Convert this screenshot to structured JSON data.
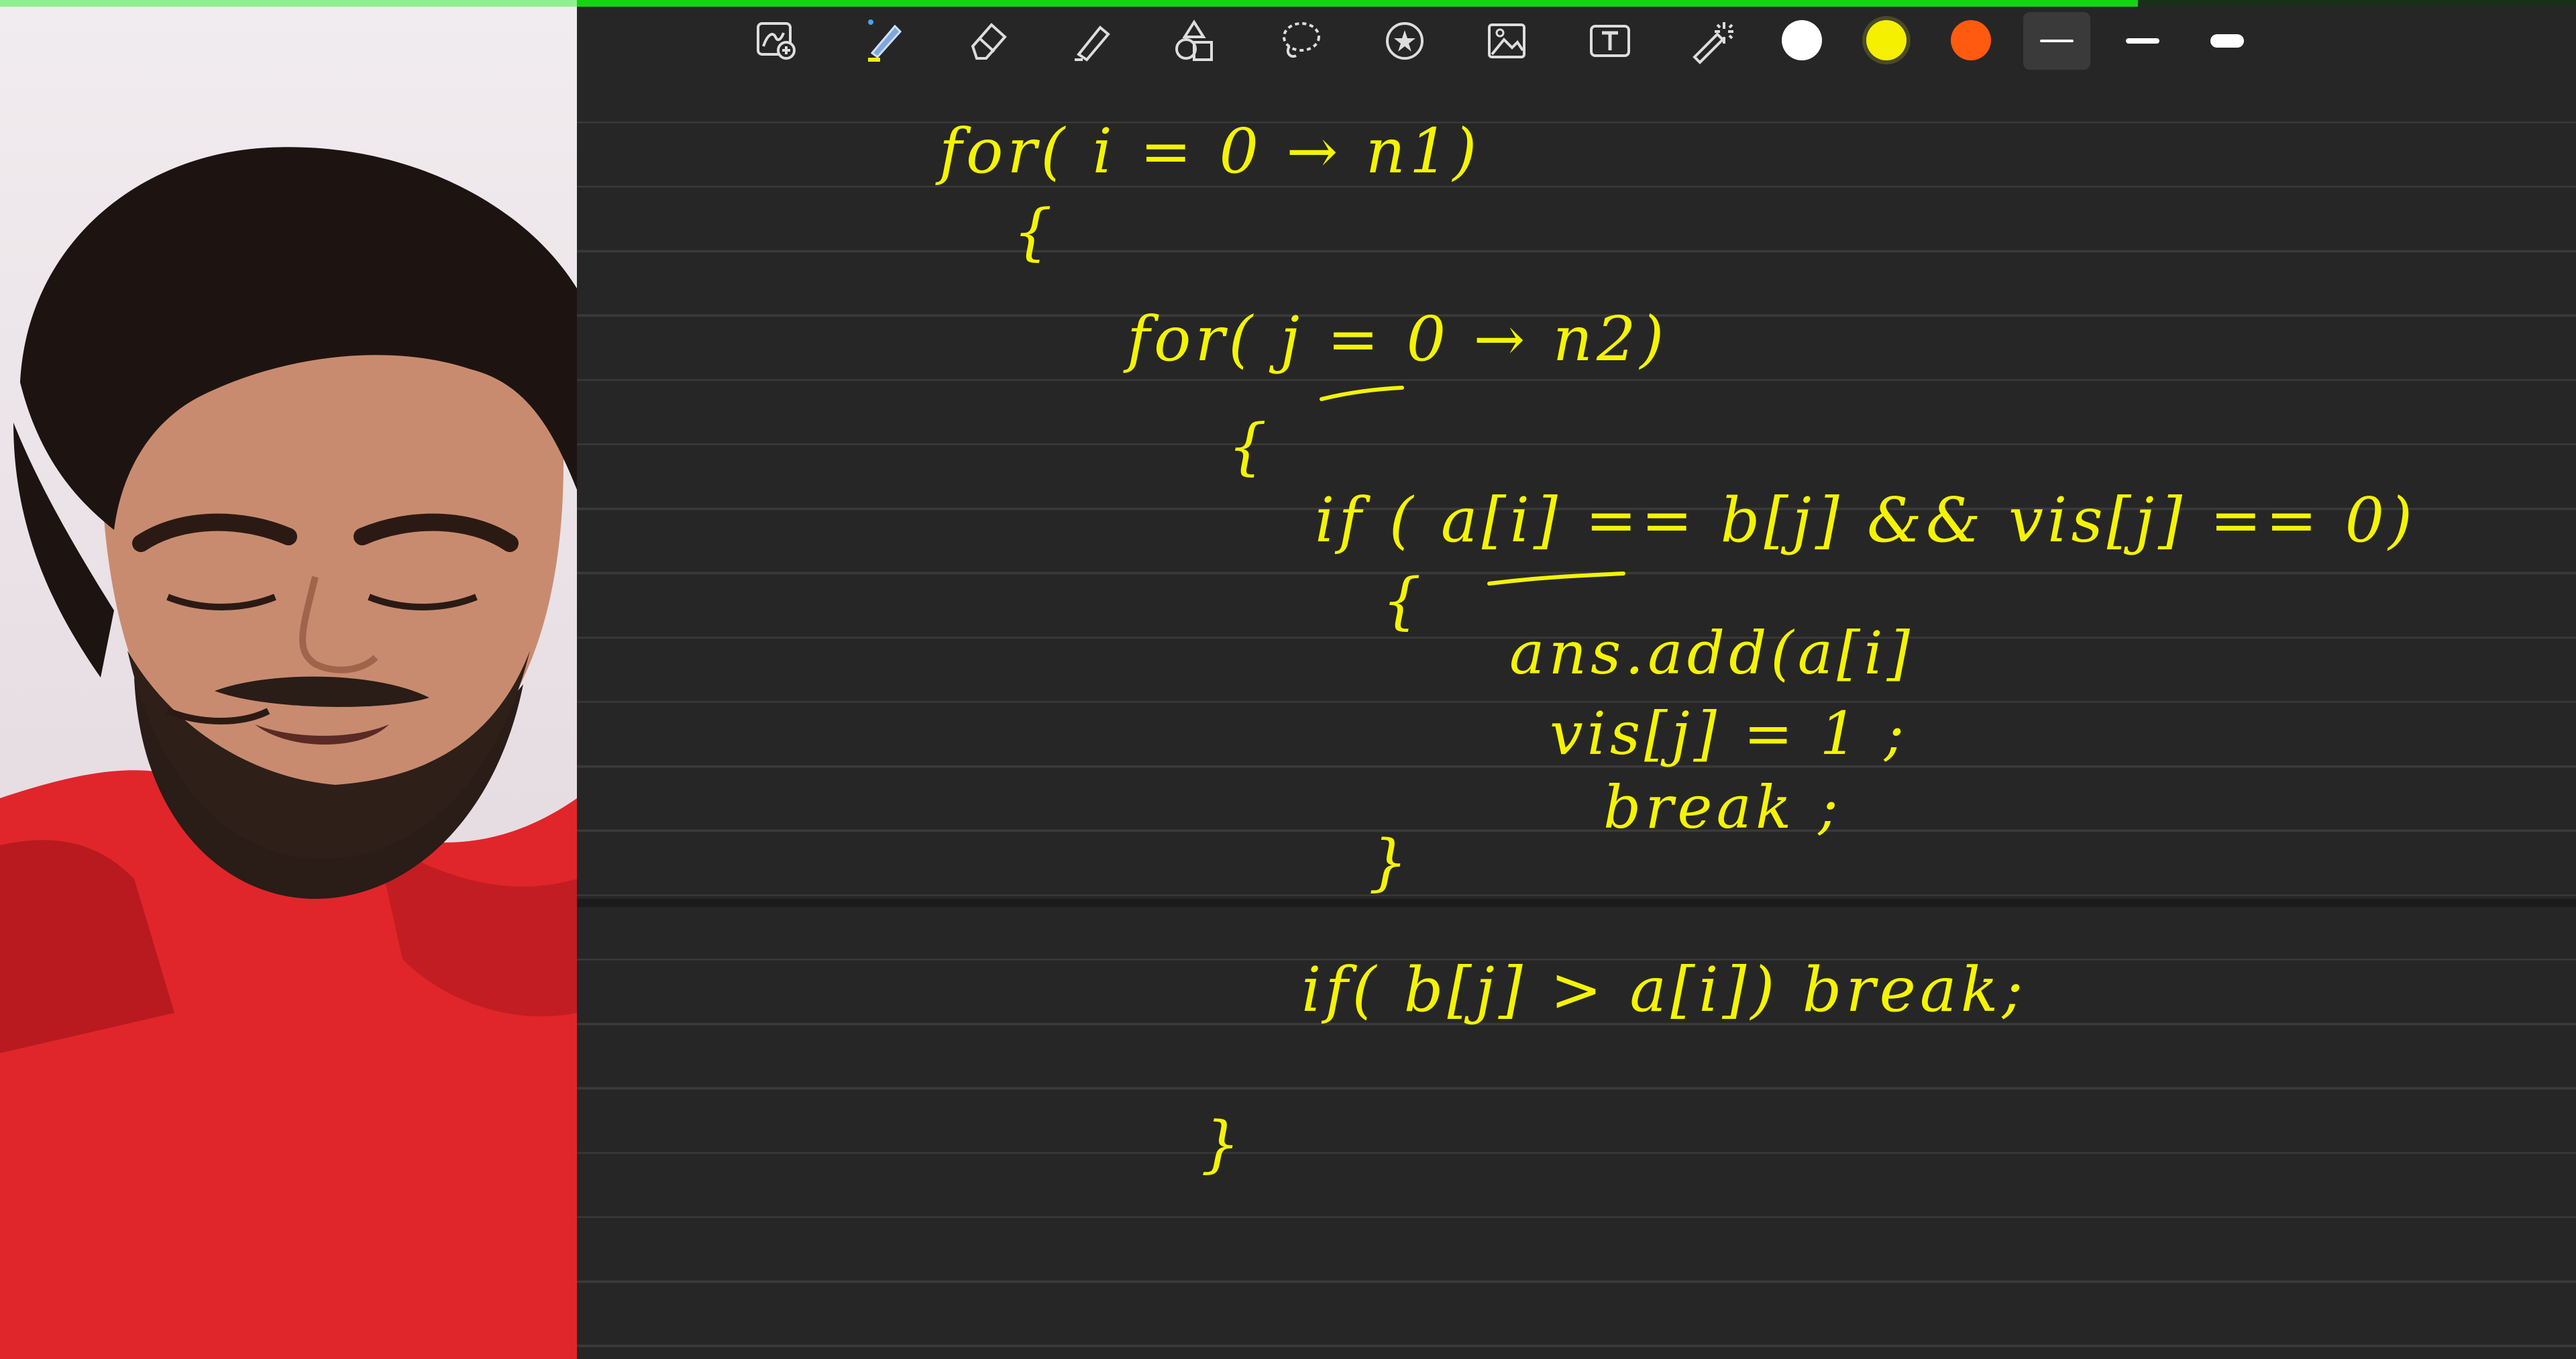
{
  "app": {
    "toolbar": {
      "tools": [
        {
          "name": "zoom-tool",
          "icon": "zoom-pen-icon"
        },
        {
          "name": "pen-tool",
          "icon": "pen-icon",
          "selected": true
        },
        {
          "name": "eraser-tool",
          "icon": "eraser-icon"
        },
        {
          "name": "highlighter-tool",
          "icon": "highlighter-icon"
        },
        {
          "name": "shapes-tool",
          "icon": "shapes-icon"
        },
        {
          "name": "lasso-tool",
          "icon": "lasso-icon"
        },
        {
          "name": "sticker-tool",
          "icon": "star-sticker-icon"
        },
        {
          "name": "image-tool",
          "icon": "image-icon"
        },
        {
          "name": "text-tool",
          "icon": "text-box-icon"
        },
        {
          "name": "laser-tool",
          "icon": "laser-pointer-icon"
        }
      ],
      "colors": [
        "#ffffff",
        "#f5f000",
        "#ff5a10"
      ],
      "selected_color": "#f5f000",
      "strokes": [
        "thin",
        "medium",
        "thick"
      ],
      "selected_stroke": "thin"
    },
    "progress": 0.83
  },
  "notes": {
    "line1": "for( i = 0 → n1)",
    "brace1": "{",
    "line2": "for( j = 0 → n2)",
    "brace2": "{",
    "line3": "if ( a[i] == b[j] && vis[j] == 0)",
    "brace3": "{",
    "line4": "ans.add(a[i]",
    "line5": "vis[j] = 1 ;",
    "line6": "break ;",
    "brace4": "}",
    "line7": "if( b[j] > a[i]) break;",
    "brace5": "}"
  },
  "colors": {
    "ink": "#f4f400",
    "page": "#262626",
    "rule": "#3a3a3a",
    "hoodie": "#e0262a"
  }
}
